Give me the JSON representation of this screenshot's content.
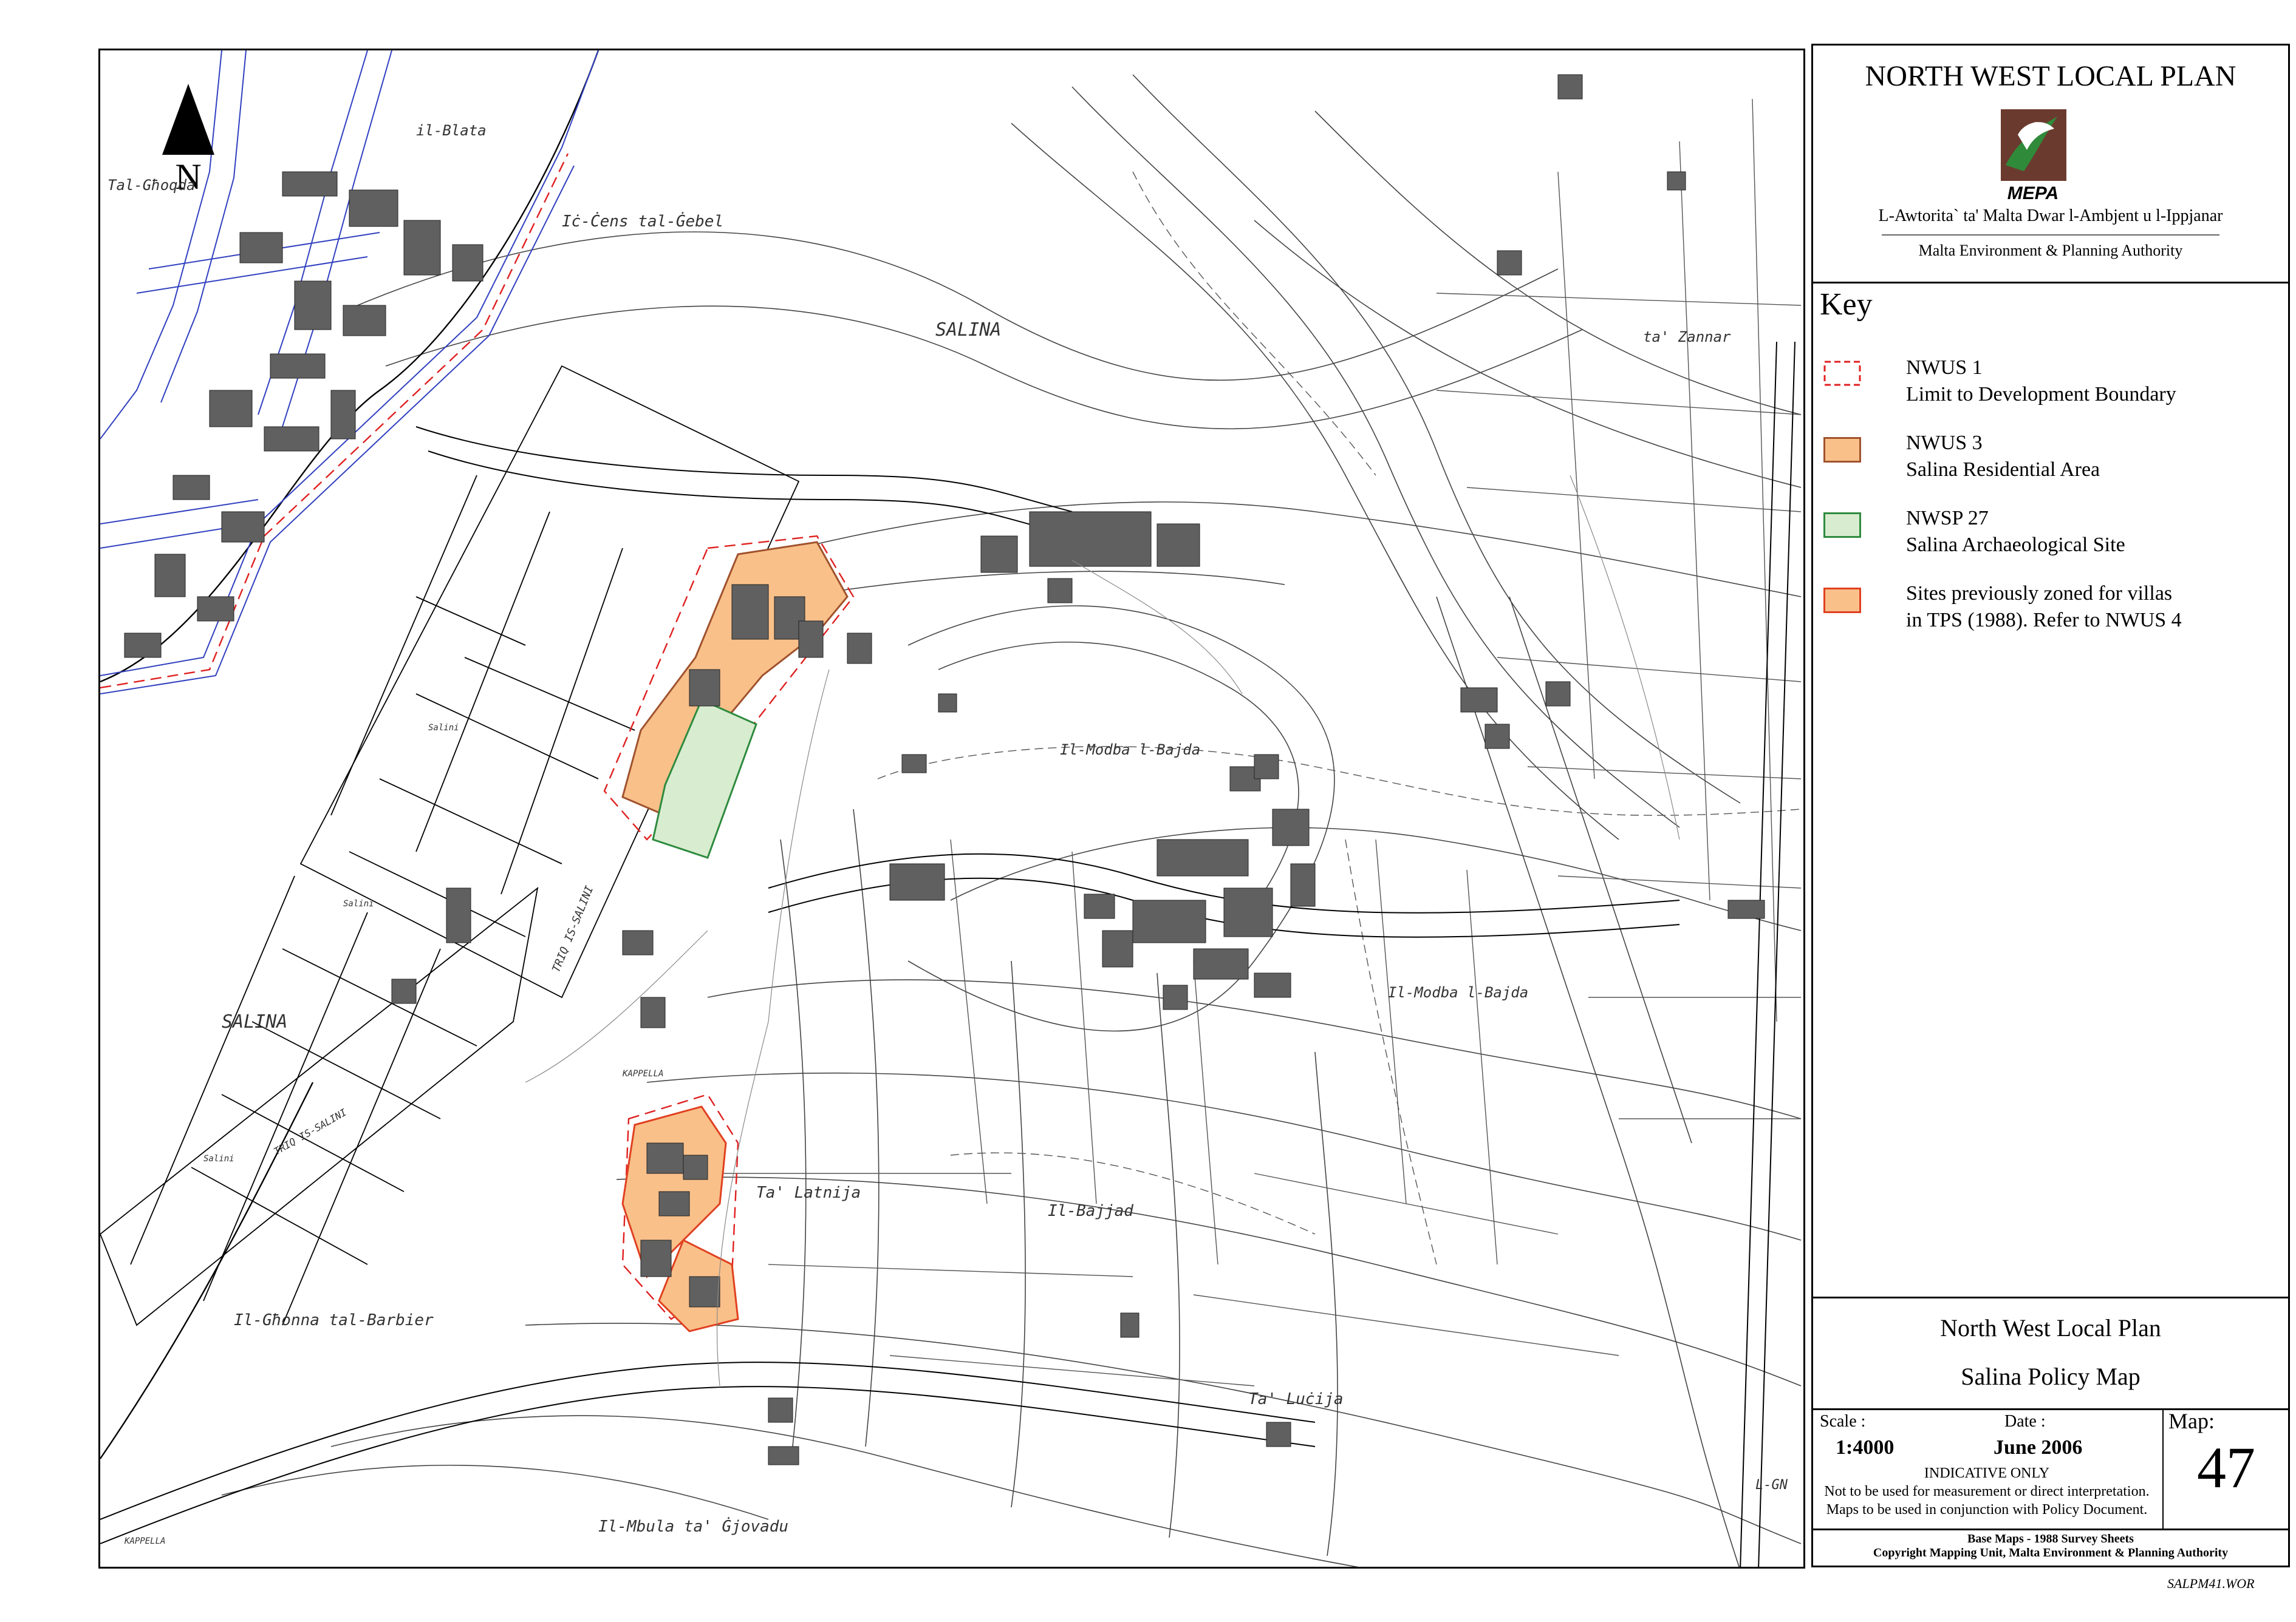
{
  "north_arrow": {
    "label": "N"
  },
  "map_labels": [
    {
      "text": "SALINA"
    },
    {
      "text": "SALINA"
    },
    {
      "text": "Tal-Għoqda"
    },
    {
      "text": "Iċ-Ċens tal-Ġebel"
    },
    {
      "text": "il-Blata"
    },
    {
      "text": "ta' Zannar"
    },
    {
      "text": "Il-Modba l-Bajda"
    },
    {
      "text": "Il-Modba l-Bajda"
    },
    {
      "text": "Ta' Latnija"
    },
    {
      "text": "Il-Bajjad"
    },
    {
      "text": "Il-Għonna tal-Barbier"
    },
    {
      "text": "Ta' Luċija"
    },
    {
      "text": "Il-Mbula ta' Ġjovadu"
    },
    {
      "text": "TRIQ IS-SALINI"
    },
    {
      "text": "TRIQ IS-SALINI"
    },
    {
      "text": "KAPPELLA"
    },
    {
      "text": "KAPPELLA"
    },
    {
      "text": "Salini"
    },
    {
      "text": "Salini"
    },
    {
      "text": "Salini"
    },
    {
      "text": "L-GN"
    }
  ],
  "panel": {
    "plan_title": "NORTH WEST LOCAL PLAN",
    "logo_text": "MEPA",
    "authority_mt": "L-Awtorita` ta' Malta Dwar l-Ambjent u l-Ippjanar",
    "authority_en": "Malta Environment & Planning Authority",
    "key_title": "Key",
    "key_items": [
      {
        "code": "NWUS 1",
        "desc": "Limit to Development Boundary",
        "style": "dashed-red"
      },
      {
        "code": "NWUS 3",
        "desc": "Salina Residential Area",
        "style": "fill",
        "fill": "#f9c08a",
        "stroke": "#a0522d"
      },
      {
        "code": "NWSP 27",
        "desc": "Salina Archaeological Site",
        "style": "fill",
        "fill": "#d8ecd0",
        "stroke": "#2e8b3e"
      },
      {
        "code": "Sites previously zoned for villas",
        "desc": "in TPS (1988). Refer to NWUS 4",
        "style": "fill",
        "fill": "#f9c08a",
        "stroke": "#e04020"
      }
    ],
    "footer_title1": "North West Local Plan",
    "footer_title2": "Salina Policy Map",
    "scale_label": "Scale :",
    "scale_value": "1:4000",
    "date_label": "Date :",
    "date_value": "June 2006",
    "map_label": "Map:",
    "map_number": "47",
    "indicative": "INDICATIVE ONLY",
    "disclaimer1": "Not to be used for measurement or direct interpretation.",
    "disclaimer2": "Maps to be used in conjunction with Policy Document.",
    "credit1": "Base Maps - 1988 Survey Sheets",
    "credit2": "Copyright Mapping Unit, Malta Environment & Planning Authority"
  },
  "drawing_ref": "SALPM41.WOR",
  "colors": {
    "residential": "#f9c08a",
    "archaeological": "#d8ecd0",
    "boundary": "#e02020",
    "roads": "#3040c0",
    "buildings": "#606060"
  }
}
